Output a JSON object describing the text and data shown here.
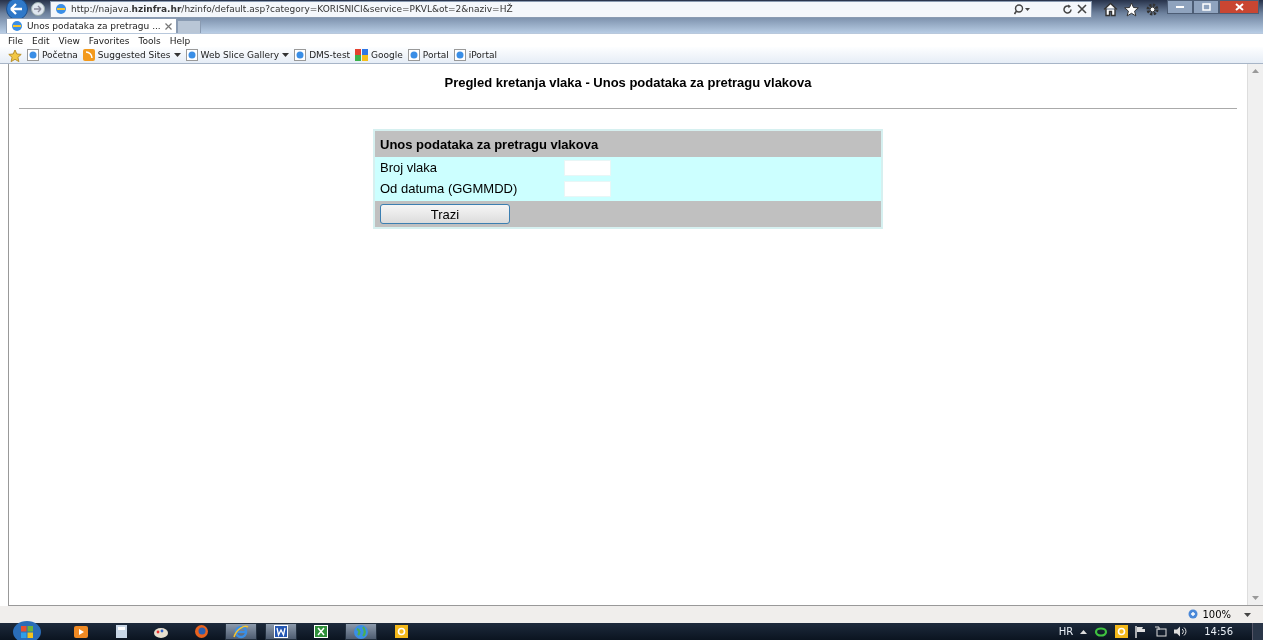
{
  "address_bar": {
    "url": "http://najava.**hzinfra.hr**/hzinfo/default.asp?category=KORISNICI&service=PKVL&ot=2&naziv=HŽ"
  },
  "tabs": [
    {
      "label": "Unos podataka za pretragu ...",
      "selected": true
    }
  ],
  "menu": [
    "File",
    "Edit",
    "View",
    "Favorites",
    "Tools",
    "Help"
  ],
  "favorites": [
    {
      "label": "Početna",
      "kind": "page",
      "dropdown": false
    },
    {
      "label": "Suggested Sites",
      "kind": "feed",
      "dropdown": true
    },
    {
      "label": "Web Slice Gallery",
      "kind": "page",
      "dropdown": true
    },
    {
      "label": "DMS-test",
      "kind": "page",
      "dropdown": false
    },
    {
      "label": "Google",
      "kind": "google",
      "dropdown": false
    },
    {
      "label": "Portal",
      "kind": "page",
      "dropdown": false
    },
    {
      "label": "iPortal",
      "kind": "page",
      "dropdown": false
    }
  ],
  "page": {
    "heading": "Pregled kretanja vlaka - Unos podataka za pretragu vlakova",
    "form": {
      "title": "Unos podataka za pretragu vlakova",
      "fields": [
        {
          "label": "Broj vlaka"
        },
        {
          "label": "Od datuma (GGMMDD)"
        }
      ],
      "button": "Trazi"
    }
  },
  "status_bar": {
    "zoom": "100%"
  },
  "taskbar": {
    "language": "HR",
    "clock": "14:56"
  }
}
